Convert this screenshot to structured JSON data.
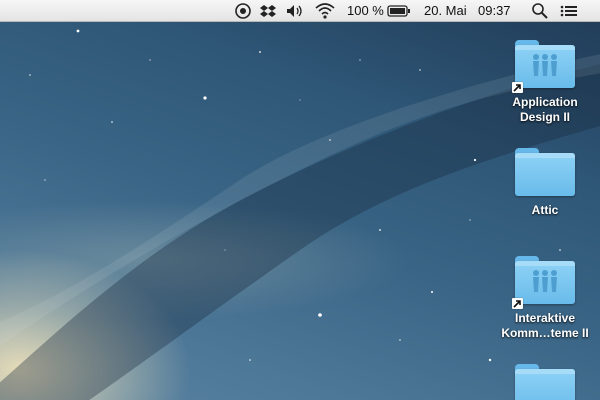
{
  "menubar": {
    "status_icons": [
      "status-ring-icon",
      "dropbox-icon",
      "volume-icon",
      "wifi-icon"
    ],
    "battery": {
      "label": "100 %",
      "level": 1.0
    },
    "date": "20. Mai",
    "time": "09:37",
    "spotlight_icon": "search-icon",
    "notification_icon": "notification-list-icon"
  },
  "desktop": {
    "icons": [
      {
        "label": "Application\nDesign II",
        "kind": "shared-folder",
        "alias": true
      },
      {
        "label": "Attic",
        "kind": "folder",
        "alias": false
      },
      {
        "label": "Interaktive\nKomm…teme II",
        "kind": "shared-folder",
        "alias": true
      },
      {
        "label": "",
        "kind": "folder",
        "alias": false
      }
    ]
  },
  "colors": {
    "menubar_bg": "#eeeeee",
    "folder_blue": "#74c2ee",
    "wallpaper_dark": "#203a55",
    "galaxy_glow": "#ffecbe"
  }
}
